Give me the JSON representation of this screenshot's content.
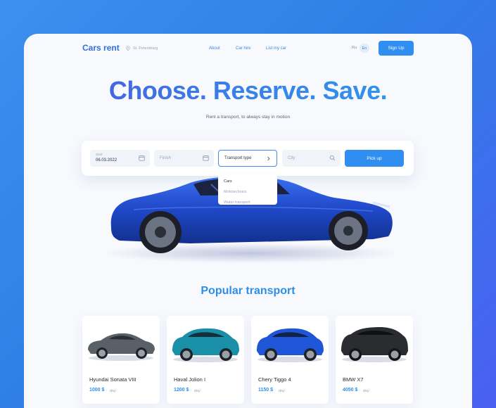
{
  "header": {
    "logo": "Cars rent",
    "city": "St. Petersburg",
    "nav": [
      "About",
      "Car hire",
      "List my car"
    ],
    "lang_ru": "Ru",
    "lang_en": "En",
    "signup_label": "Sign Up"
  },
  "hero": {
    "title": "Choose. Reserve. Save.",
    "tagline": "Rent a transport, to always stay in motion"
  },
  "search": {
    "start_label": "Start",
    "start_value": "06.03.2022",
    "finish_placeholder": "Finish",
    "type_placeholder": "Transport type",
    "city_placeholder": "City",
    "pickup_label": "Pick up",
    "type_options": [
      "Cars",
      "Mototechnics",
      "Water transport"
    ]
  },
  "popular": {
    "title": "Popular transport",
    "cards": [
      {
        "name": "Hyundai Sonata VIII",
        "price": "1000 $",
        "per": "day",
        "color": "#5a6068"
      },
      {
        "name": "Haval Jolion I",
        "price": "1200 $",
        "per": "day",
        "color": "#1a8fa8"
      },
      {
        "name": "Chery Tiggo 4",
        "price": "1150 $",
        "per": "day",
        "color": "#1f56d8"
      },
      {
        "name": "BMW X7",
        "price": "4050 $",
        "per": "day",
        "color": "#2a2c30"
      }
    ]
  },
  "colors": {
    "accent": "#2f8ef0",
    "headline_start": "#4a55e0",
    "headline_end": "#2d9cf0"
  }
}
